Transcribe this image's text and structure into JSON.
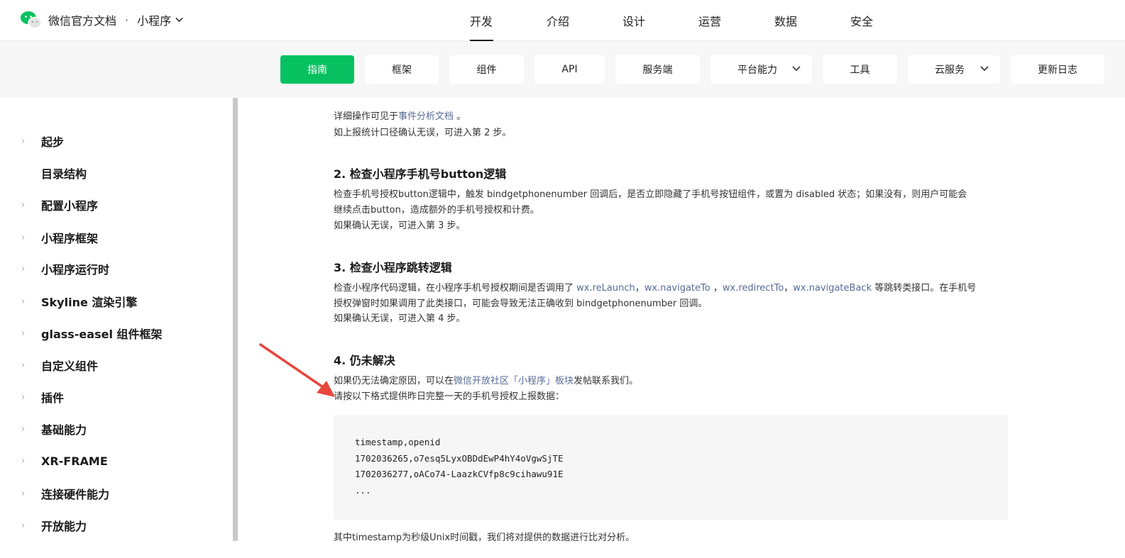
{
  "header": {
    "brand_title": "微信官方文档",
    "brand_dot": "·",
    "product": "小程序",
    "nav": [
      "开发",
      "介绍",
      "设计",
      "运营",
      "数据",
      "安全"
    ],
    "active_nav": "开发"
  },
  "subnav": {
    "items": [
      "指南",
      "框架",
      "组件",
      "API",
      "服务端",
      "平台能力",
      "工具",
      "云服务",
      "更新日志"
    ],
    "active": "指南"
  },
  "sidebar": {
    "items": [
      "起步",
      "目录结构",
      "配置小程序",
      "小程序框架",
      "小程序运行时",
      "Skyline 渲染引擎",
      "glass-easel 组件框架",
      "自定义组件",
      "插件",
      "基础能力",
      "XR-FRAME",
      "连接硬件能力",
      "开放能力"
    ]
  },
  "content": {
    "p1_prefix": "详细操作可见于",
    "p1_link": "事件分析文档",
    "p1_suffix": " 。",
    "p2": "如上报统计口径确认无误，可进入第 2 步。",
    "h2": "2. 检查小程序手机号button逻辑",
    "p3": "检查手机号授权button逻辑中，触发 bindgetphonenumber 回调后，是否立即隐藏了手机号按钮组件，或置为 disabled 状态；如果没有，则用户可能会",
    "p3b": "继续点击button，造成额外的手机号授权和计费。",
    "p4": "如果确认无误，可进入第 3 步。",
    "h3": "3. 检查小程序跳转逻辑",
    "p5_a": "检查小程序代码逻辑，在小程序手机号授权期间是否调用了 ",
    "p5_l1": "wx.reLaunch",
    "p5_s1": "，",
    "p5_l2": "wx.navigateTo",
    "p5_s2": " ，",
    "p5_l3": "wx.redirectTo",
    "p5_s3": "，",
    "p5_l4": "wx.navigateBack",
    "p5_b": " 等跳转类接口。在手机号",
    "p5c": "授权弹窗时如果调用了此类接口，可能会导致无法正确收到 bindgetphonenumber 回调。",
    "p6": "如果确认无误，可进入第 4 步。",
    "h4": "4. 仍未解决",
    "p7_a": "如果仍无法确定原因，可以在",
    "p7_link": "微信开放社区「小程序」板块",
    "p7_b": "发帖联系我们。",
    "p8": "请按以下格式提供昨日完整一天的手机号授权上报数据：",
    "code": [
      "timestamp,openid",
      "1702036265,o7esq5LyxOBDdEwP4hY4oVgwSjTE",
      "1702036277,oACo74-LaazkCVfp8c9cihawu91E",
      "..."
    ],
    "p9": "其中timestamp为秒级Unix时间戳，我们将对提供的数据进行比对分析。"
  },
  "colors": {
    "accent": "#07c160",
    "link": "#576b95",
    "annotation_arrow": "#e8453c"
  }
}
